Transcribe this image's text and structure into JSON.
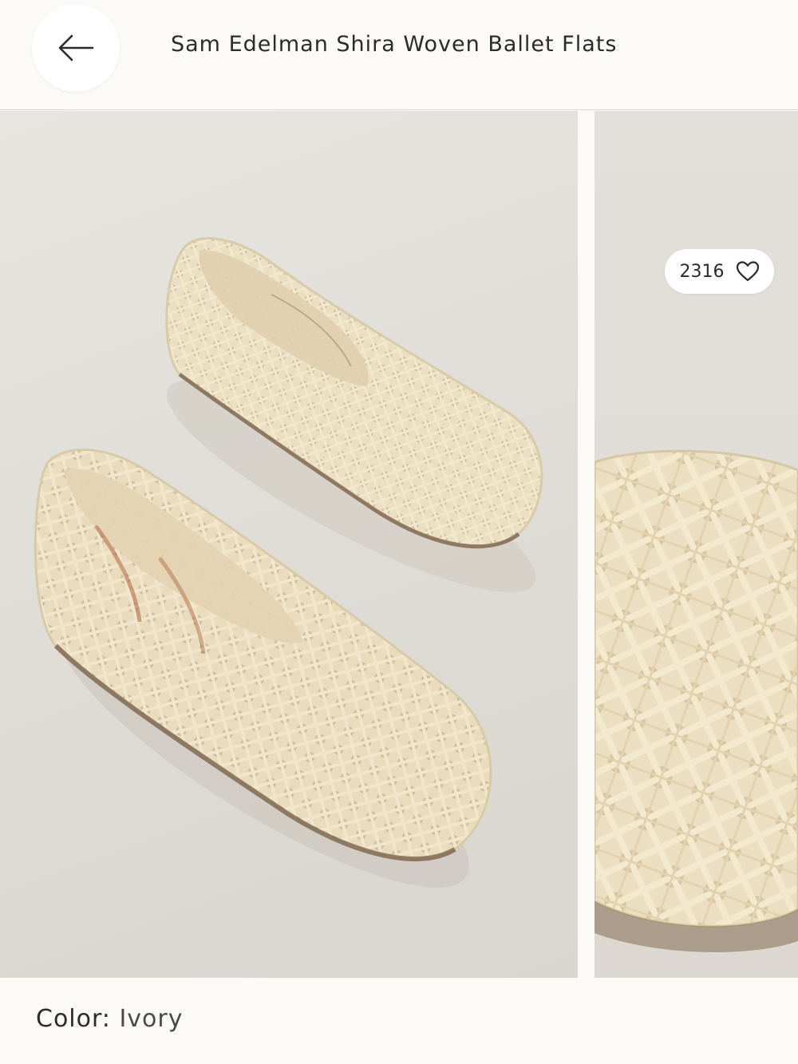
{
  "header": {
    "title": "Sam Edelman Shira Woven Ballet Flats",
    "back_icon": "arrow-left-icon"
  },
  "gallery": {
    "likes_count": "2316",
    "like_icon": "heart-outline-icon",
    "images": [
      "woven-ballet-flats-pair",
      "woven-ballet-flat-closeup"
    ]
  },
  "product": {
    "color_label": "Color:",
    "color_value": "Ivory"
  },
  "colors": {
    "background": "#fbfaf7",
    "text": "#2b2b2b",
    "shoe": "#ece0c3"
  }
}
